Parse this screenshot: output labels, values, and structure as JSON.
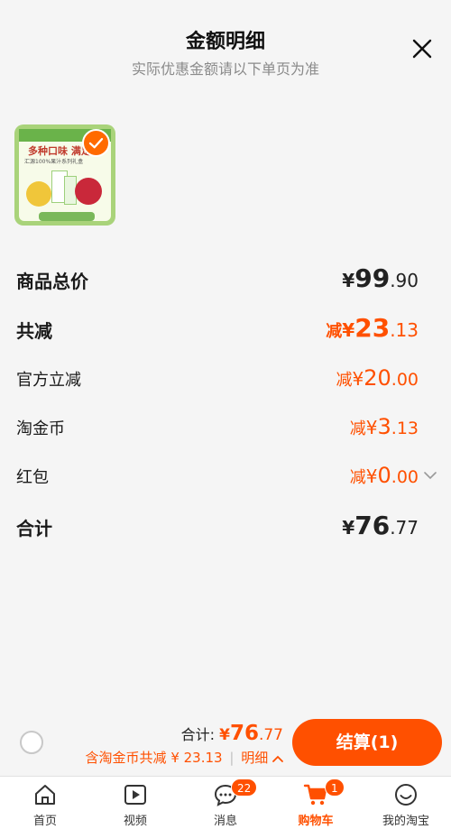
{
  "header": {
    "title": "金额明细",
    "subtitle": "实际优惠金额请以下单页为准"
  },
  "product": {
    "image_texts": {
      "line1": "多种口味 满足",
      "line2": "汇源100%果汁系列礼盒"
    }
  },
  "summary": {
    "total_price": {
      "label": "商品总价",
      "currency": "¥",
      "int": "99",
      "dec": ".90"
    },
    "total_reduce": {
      "label": "共减",
      "prefix": "减",
      "currency": "¥",
      "int": "23",
      "dec": ".13"
    },
    "official_reduce": {
      "label": "官方立减",
      "prefix": "减",
      "currency": "¥",
      "int": "20",
      "dec": ".00"
    },
    "taobao_coin": {
      "label": "淘金币",
      "prefix": "减",
      "currency": "¥",
      "int": "3",
      "dec": ".13"
    },
    "red_packet": {
      "label": "红包",
      "prefix": "减",
      "currency": "¥",
      "int": "0",
      "dec": ".00"
    },
    "grand_total": {
      "label": "合计",
      "currency": "¥",
      "int": "76",
      "dec": ".77"
    }
  },
  "bottom": {
    "total_label": "合计:",
    "total_currency": "¥",
    "total_int": "76",
    "total_dec": ".77",
    "coin_reduce_text": "含淘金币共减 ¥ 23.13",
    "separator": "|",
    "detail_label": "明细",
    "checkout_label": "结算(1)"
  },
  "tabbar": {
    "items": [
      {
        "label": "首页",
        "icon": "home-icon"
      },
      {
        "label": "视频",
        "icon": "video-play-icon"
      },
      {
        "label": "消息",
        "icon": "message-icon",
        "badge": "22"
      },
      {
        "label": "购物车",
        "icon": "cart-icon",
        "badge": "1",
        "active": true
      },
      {
        "label": "我的淘宝",
        "icon": "profile-smile-icon"
      }
    ]
  },
  "colors": {
    "accent": "#ff5000",
    "background": "#f5f5f5"
  }
}
